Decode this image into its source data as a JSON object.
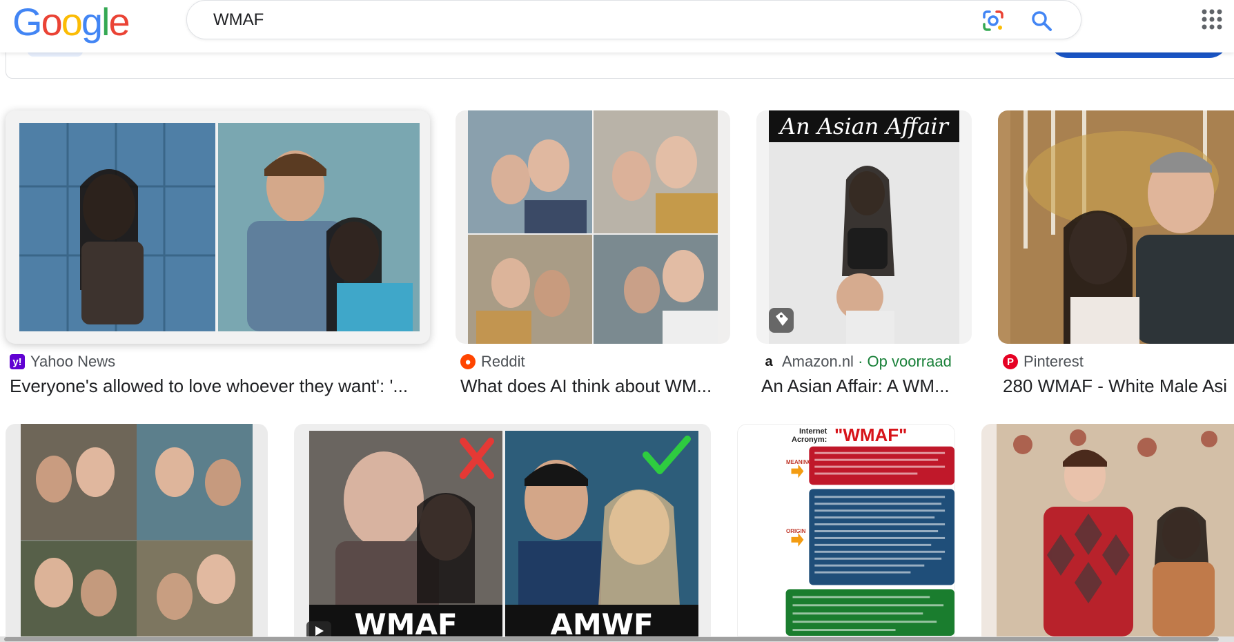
{
  "header": {
    "logo_letters": [
      "G",
      "o",
      "o",
      "g",
      "l",
      "e"
    ],
    "logo_colors": [
      "#4285F4",
      "#EA4335",
      "#FBBC05",
      "#4285F4",
      "#34A853",
      "#EA4335"
    ],
    "search_value": "WMAF"
  },
  "colors": {
    "accent_blue": "#1a56c7",
    "stock_green": "#188038"
  },
  "results_row1": [
    {
      "source": "Yahoo News",
      "favicon": "yahoo-icon",
      "title": "Everyone's allowed to love whoever they want': '..."
    },
    {
      "source": "Reddit",
      "favicon": "reddit-icon",
      "title": "What does AI think about WM..."
    },
    {
      "source": "Amazon.nl",
      "favicon": "amazon-icon",
      "stock": "· Op voorraad",
      "title": "An Asian Affair: A WM...",
      "image_text": "An Asian Affair"
    },
    {
      "source": "Pinterest",
      "favicon": "pinterest-icon",
      "title": "280 WMAF - White Male Asi"
    }
  ],
  "results_row2": [
    {
      "image_text": ""
    },
    {
      "image_text_left": "WMAF",
      "image_text_right": "AMWF"
    },
    {
      "header_label_1": "Internet",
      "header_label_2": "Acronym:",
      "header_title": "\"WMAF\"",
      "meaning_label": "MEANING",
      "origin_label": "ORIGIN"
    },
    {
      "image_text": ""
    }
  ]
}
